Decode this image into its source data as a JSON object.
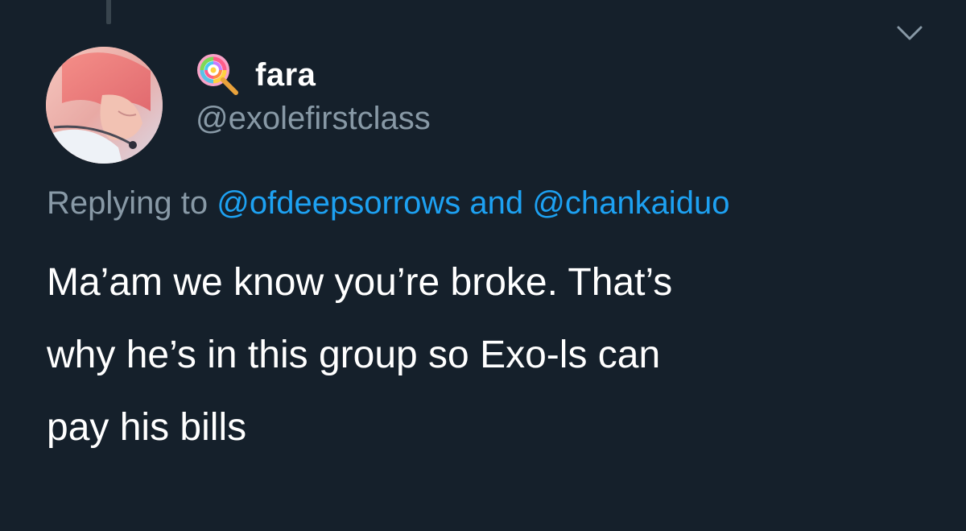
{
  "tweet": {
    "display_name": "fara",
    "handle": "@exolefirstclass",
    "reply": {
      "prefix": "Replying to",
      "mention_1": "@ofdeepsorrows",
      "mention_2": "@chankaiduo",
      "joiner": "and"
    },
    "text_lines": [
      "Ma’am we know you’re broke. That’s",
      "why he’s in this group so Exo-ls can",
      "pay his bills"
    ],
    "name_emoji_icon": "lollipop-icon",
    "menu_icon": "chevron-down-icon"
  },
  "colors": {
    "background": "#15202b",
    "primary_text": "#ffffff",
    "secondary_text": "#8899a6",
    "link": "#1da1f2",
    "thread_line": "#38444d"
  }
}
